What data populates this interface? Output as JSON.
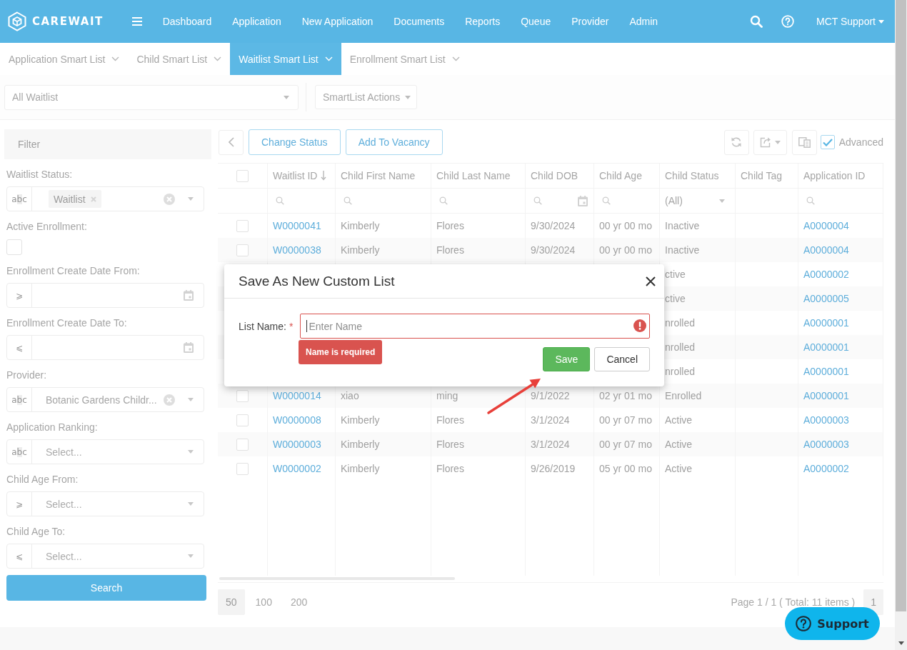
{
  "nav": {
    "logo": "CAREWAIT",
    "items": [
      "Dashboard",
      "Application",
      "New Application",
      "Documents",
      "Reports",
      "Queue",
      "Provider",
      "Admin"
    ],
    "user": "MCT Support"
  },
  "smart_list_tabs": [
    {
      "label": "Application Smart List",
      "selected": false
    },
    {
      "label": "Child Smart List",
      "selected": false
    },
    {
      "label": "Waitlist Smart List",
      "selected": true
    },
    {
      "label": "Enrollment Smart List",
      "selected": false
    }
  ],
  "list_bar": {
    "view": "All Waitlist",
    "actions": "SmartList Actions"
  },
  "filter_panel": {
    "title": "Filter",
    "fields": [
      {
        "kind": "tags",
        "label": "Waitlist Status:",
        "prefix": "a**b**c",
        "tags": [
          "Waitlist"
        ],
        "clearable": true
      },
      {
        "kind": "checkbox",
        "label": "Active Enrollment:",
        "checked": false
      },
      {
        "kind": "date",
        "label": "Enrollment Create Date From:",
        "prefix": "⩾"
      },
      {
        "kind": "date",
        "label": "Enrollment Create Date To:",
        "prefix": "⩽"
      },
      {
        "kind": "select",
        "label": "Provider:",
        "prefix": "a**b**c",
        "value": "Botanic Gardens Childr...",
        "clearable": true
      },
      {
        "kind": "select",
        "label": "Application Ranking:",
        "prefix": "a**b**c",
        "placeholder": "Select...",
        "clearable": false
      },
      {
        "kind": "select",
        "label": "Child Age From:",
        "prefix": "⩾",
        "placeholder": "Select...",
        "clearable": false
      },
      {
        "kind": "select",
        "label": "Child Age To:",
        "prefix": "⩽",
        "placeholder": "Select...",
        "clearable": false
      }
    ],
    "search_button": "Search"
  },
  "toolbar": {
    "buttons": [
      {
        "label": "Change Status"
      },
      {
        "label": "Add To Vacancy"
      }
    ],
    "advanced": {
      "label": "Advanced",
      "checked": true
    }
  },
  "table": {
    "select_all": {
      "checked": false
    },
    "columns": [
      {
        "label": "Waitlist ID",
        "kind": "link",
        "sorted": true
      },
      {
        "label": "Child First Name",
        "kind": "text",
        "sorted": false
      },
      {
        "label": "Child Last Name",
        "kind": "text",
        "sorted": false
      },
      {
        "label": "Child DOB",
        "kind": "text",
        "sorted": false
      },
      {
        "label": "Child Age",
        "kind": "text",
        "sorted": false
      },
      {
        "label": "Child Status",
        "kind": "text",
        "sorted": false
      },
      {
        "label": "Child Tag",
        "sorted": false
      },
      {
        "label": "Application ID",
        "kind": "link",
        "sorted": false
      }
    ],
    "filter_row": [
      {
        "kind": "search"
      },
      {
        "kind": "search"
      },
      {
        "kind": "search"
      },
      {
        "kind": "date"
      },
      {
        "kind": "search"
      },
      {
        "kind": "select",
        "value": "(All)"
      },
      {
        "kind": "empty"
      },
      {
        "kind": "search"
      }
    ],
    "rows": [
      {
        "checked": false,
        "waitlist_id": "W0000041",
        "first_name": "Kimberly",
        "last_name": "Flores",
        "dob": "9/30/2024",
        "age": "00 yr 00 mo",
        "status": "Inactive",
        "application_id": "A0000004"
      },
      {
        "checked": false,
        "waitlist_id": "W0000038",
        "first_name": "Kimberly",
        "last_name": "Flores",
        "dob": "9/30/2024",
        "age": "00 yr 00 mo",
        "status": "Inactive",
        "application_id": "A0000004"
      },
      {
        "status": "ctive",
        "application_id": "A0000002"
      },
      {
        "status": "ctive",
        "application_id": "A0000005"
      },
      {
        "status": "nrolled",
        "application_id": "A0000001"
      },
      {
        "status": "nrolled",
        "application_id": "A0000001"
      },
      {
        "status": "nrolled",
        "application_id": "A0000001"
      },
      {
        "checked": false,
        "waitlist_id": "W0000014",
        "first_name": "xiao",
        "last_name": "ming",
        "dob": "9/1/2022",
        "age": "02 yr 01 mo",
        "status": "Enrolled",
        "application_id": "A0000001"
      },
      {
        "checked": false,
        "waitlist_id": "W0000008",
        "first_name": "Kimberly",
        "last_name": "Flores",
        "dob": "3/1/2024",
        "age": "00 yr 07 mo",
        "status": "Active",
        "application_id": "A0000003"
      },
      {
        "checked": false,
        "waitlist_id": "W0000003",
        "first_name": "Kimberly",
        "last_name": "Flores",
        "dob": "3/1/2024",
        "age": "00 yr 07 mo",
        "status": "Active",
        "application_id": "A0000003"
      },
      {
        "checked": false,
        "waitlist_id": "W0000002",
        "first_name": "Kimberly",
        "last_name": "Flores",
        "dob": "9/26/2019",
        "age": "05 yr 00 mo",
        "status": "Active",
        "application_id": "A0000002"
      }
    ]
  },
  "pagination": {
    "page_sizes": [
      {
        "label": "50",
        "selected": true
      },
      {
        "label": "100",
        "selected": false
      },
      {
        "label": "200",
        "selected": false
      }
    ],
    "summary": "Page 1 / 1 ( Total: 11 items )",
    "pages": [
      {
        "label": "1",
        "selected": true
      }
    ]
  },
  "support_button": "Support",
  "dialog": {
    "title": "Save As New Custom List",
    "field": {
      "label": "List Name:",
      "required_mark": "*",
      "placeholder": "Enter Name",
      "focused": true,
      "invalid": true,
      "error": "Name is required"
    },
    "buttons": [
      {
        "label": "Save",
        "kind": "primary"
      },
      {
        "label": "Cancel",
        "kind": "default"
      }
    ]
  }
}
